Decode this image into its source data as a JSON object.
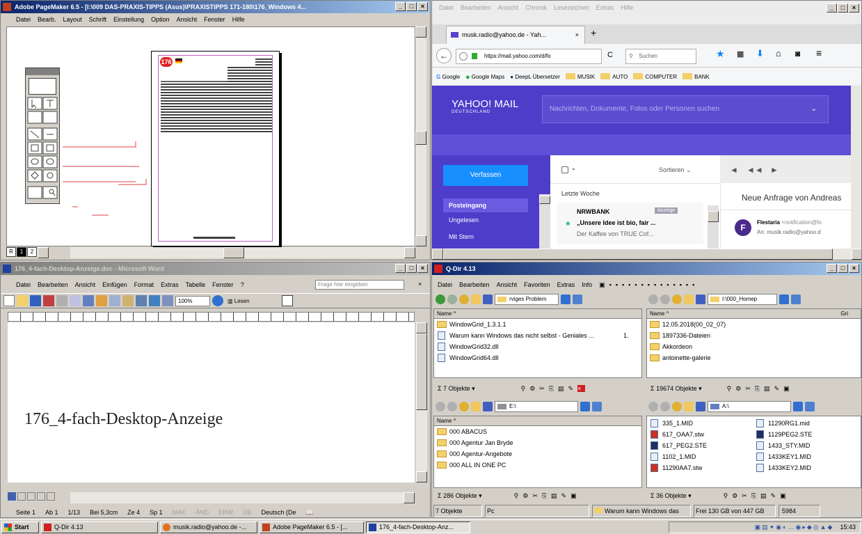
{
  "pagemaker": {
    "title": "Adobe PageMaker 6.5 - [I:\\009 DAS-PRAXIS-TIPPS (Asus)\\PRAXISTIPPS 171-180\\176_Windows 4...",
    "menu": [
      "Datei",
      "Bearb.",
      "Layout",
      "Schrift",
      "Einstellung",
      "Option",
      "Ansicht",
      "Fenster",
      "Hilfe"
    ],
    "page_badge": "176",
    "page_tabs": [
      "R",
      "1",
      "2"
    ]
  },
  "firefox": {
    "menu": [
      "Datei",
      "Bearbeiten",
      "Ansicht",
      "Chronik",
      "Lesezeichen",
      "Extras",
      "Hilfe"
    ],
    "tab_title": "musk.radio@yahoo.de - Yah...",
    "url": "https://mail.yahoo.com/d/fo",
    "search_placeholder": "Suchen",
    "bookmarks": [
      "Google",
      "Google Maps",
      "DeepL Übersetzer",
      "MUSIK",
      "AUTO",
      "COMPUTER",
      "BANK"
    ],
    "yahoo": {
      "logo": "YAHOO! MAIL",
      "logo_sub": "DEUTSCHLAND",
      "search_placeholder": "Nachrichten, Dokumente, Fotos oder Personen suchen",
      "compose": "Verfassen",
      "folders": [
        "Posteingang",
        "Ungelesen",
        "Mit Stern"
      ],
      "sort_label": "Sortieren",
      "section": "Letzte Woche",
      "mail_sender": "NRWBANK",
      "mail_badge": "Anzeige",
      "mail_subject": "„Unsere Idee ist bio, fair ...",
      "mail_preview": "Der Kaffee von TRUE Cof...",
      "reading_subject": "Neue Anfrage von Andreas",
      "reading_from": "Flestaria",
      "reading_from_addr": "<notification@fo",
      "reading_to": "An: musik.radio@yahoo.d"
    }
  },
  "word": {
    "title": "176_4-fach-Desktop-Anzeige.doc - Microsoft Word",
    "menu": [
      "Datei",
      "Bearbeiten",
      "Ansicht",
      "Einfügen",
      "Format",
      "Extras",
      "Tabelle",
      "Fenster",
      "?"
    ],
    "help_placeholder": "Frage hier eingeben",
    "zoom": "100%",
    "read_btn": "Lesen",
    "doc_text": "176_4-fach-Desktop-Anzeige",
    "status": [
      "Seite 1",
      "Ab 1",
      "1/13",
      "Bei 5,3cm",
      "Ze 4",
      "Sp 1",
      "MAK",
      "ÄND",
      "ERW",
      "ÜB",
      "Deutsch (De"
    ]
  },
  "qdir": {
    "title": "Q-Dir 4.13",
    "menu": [
      "Datei",
      "Bearbeiten",
      "Ansicht",
      "Favoriten",
      "Extras",
      "Info"
    ],
    "tl": {
      "addr": "rviges Problem",
      "header": "Name",
      "rows": [
        "WindowGrid_1.3.1.1",
        "Warum kann Windows das nicht selbst - Geniales ...",
        "WindowGrid32.dll",
        "WindowGrid64.dll"
      ],
      "row2_extra": "1.",
      "status": "7 Objekte"
    },
    "tr": {
      "addr": "I:\\000_Homep",
      "header": "Name",
      "header2": "Gri",
      "rows": [
        "12.05.2018(00_02_07)",
        "1897336-Dateien",
        "Akkordeon",
        "antoinette-galerie"
      ],
      "status": "19674 Objekte"
    },
    "bl": {
      "addr": "E:\\",
      "header": "Name",
      "rows": [
        "000 ABACUS",
        "000 Agentur Jan Bryde",
        "000 Agentur-Angebote",
        "000 ALL IN ONE PC"
      ],
      "status": "286 Objekte"
    },
    "br": {
      "addr": "A:\\",
      "col1": [
        "335_1.MID",
        "617_OAA7.stw",
        "617_PEG2.STE",
        "1102_1.MID",
        "11290AA7.stw"
      ],
      "col2": [
        "11290RG1.mid",
        "1129PEG2.STE",
        "1433_STY.MID",
        "1433KEY1.MID",
        "1433KEY2.MID"
      ],
      "status": "36 Objekte"
    },
    "status": [
      "7 Objekte",
      "Pc",
      "Warum kann Windows das",
      "Frei 130 GB von 447 GB",
      "5984"
    ]
  },
  "taskbar": {
    "start": "Start",
    "items": [
      "Q-Dir 4.13",
      "musik.radio@yahoo.de -...",
      "Adobe PageMaker 6.5 - [...",
      "176_4-fach-Desktop-Anz..."
    ],
    "clock": "15:43"
  },
  "colors": {
    "titlebar": "#0a246a",
    "yahoo_purple": "#4d3dc9",
    "yahoo_blue": "#188fff",
    "win_gray": "#d4d0c8"
  }
}
